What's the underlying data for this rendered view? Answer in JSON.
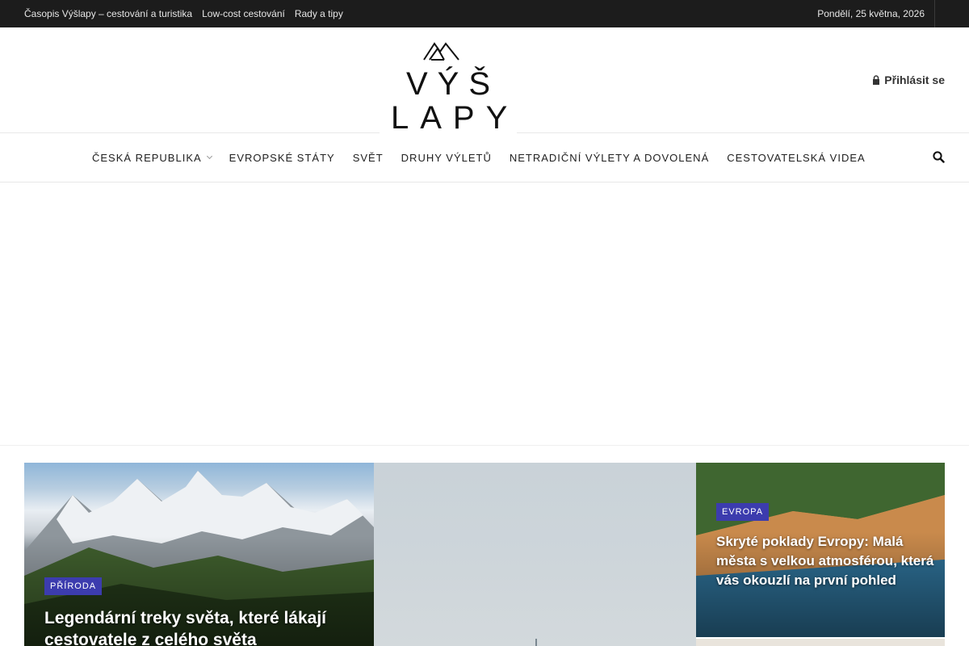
{
  "topbar": {
    "links": [
      "Časopis Výšlapy – cestování a turistika",
      "Low-cost cestování",
      "Rady a tipy"
    ],
    "date": "Pondělí, 25 května, 2026"
  },
  "header": {
    "logo_line1": "VÝŠ",
    "logo_line2": "LAPY",
    "login_label": "Přihlásit se"
  },
  "nav": {
    "items": [
      {
        "label": "Česká republika",
        "has_submenu": true
      },
      {
        "label": "Evropské státy"
      },
      {
        "label": "Svět"
      },
      {
        "label": "Druhy výletů"
      },
      {
        "label": "Netradiční výlety a dovolená"
      },
      {
        "label": "Cestovatelská videa"
      }
    ]
  },
  "hero": {
    "articles": [
      {
        "category": "Příroda",
        "title": "Legendární treky světa, které lákají cestovatele z celého světa"
      },
      {
        "category": "",
        "title": ""
      },
      {
        "category": "Evropa",
        "title": "Skryté poklady Evropy: Malá města s velkou atmosférou, která vás okouzlí na první pohled"
      }
    ]
  },
  "colors": {
    "topbar_bg": "#1c1c1c",
    "badge_bg": "#3c3cae"
  },
  "icons": [
    "lock-icon",
    "search-icon",
    "chevron-down-icon",
    "mountain-logo-icon"
  ]
}
